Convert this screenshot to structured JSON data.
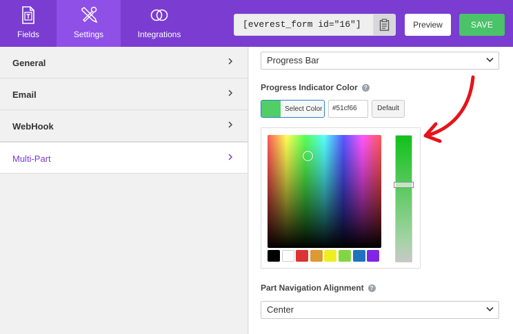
{
  "topbar": {
    "tabs": [
      {
        "label": "Fields",
        "icon": "fields-icon"
      },
      {
        "label": "Settings",
        "icon": "settings-tools-icon"
      },
      {
        "label": "Integrations",
        "icon": "integrations-rings-icon"
      }
    ],
    "shortcode": "[everest_form id=\"16\"]",
    "preview_label": "Preview",
    "save_label": "SAVE",
    "colors": {
      "bar": "#7a3cd1",
      "active_tab": "#8e50e6",
      "save": "#4ac369"
    }
  },
  "sidebar": {
    "items": [
      {
        "label": "General",
        "active": false
      },
      {
        "label": "Email",
        "active": false
      },
      {
        "label": "WebHook",
        "active": false
      },
      {
        "label": "Multi-Part",
        "active": true
      }
    ]
  },
  "main": {
    "indicator_select": {
      "value": "Progress Bar"
    },
    "color_field": {
      "label": "Progress Indicator Color",
      "select_color_label": "Select Color",
      "hex_value": "#51cf66",
      "default_label": "Default",
      "palette": [
        "#000000",
        "#ffffff",
        "#dd3333",
        "#dd9933",
        "#eeee22",
        "#81d742",
        "#1e73be",
        "#8224e3"
      ]
    },
    "alignment_field": {
      "label": "Part Navigation Alignment",
      "value": "Center"
    }
  }
}
